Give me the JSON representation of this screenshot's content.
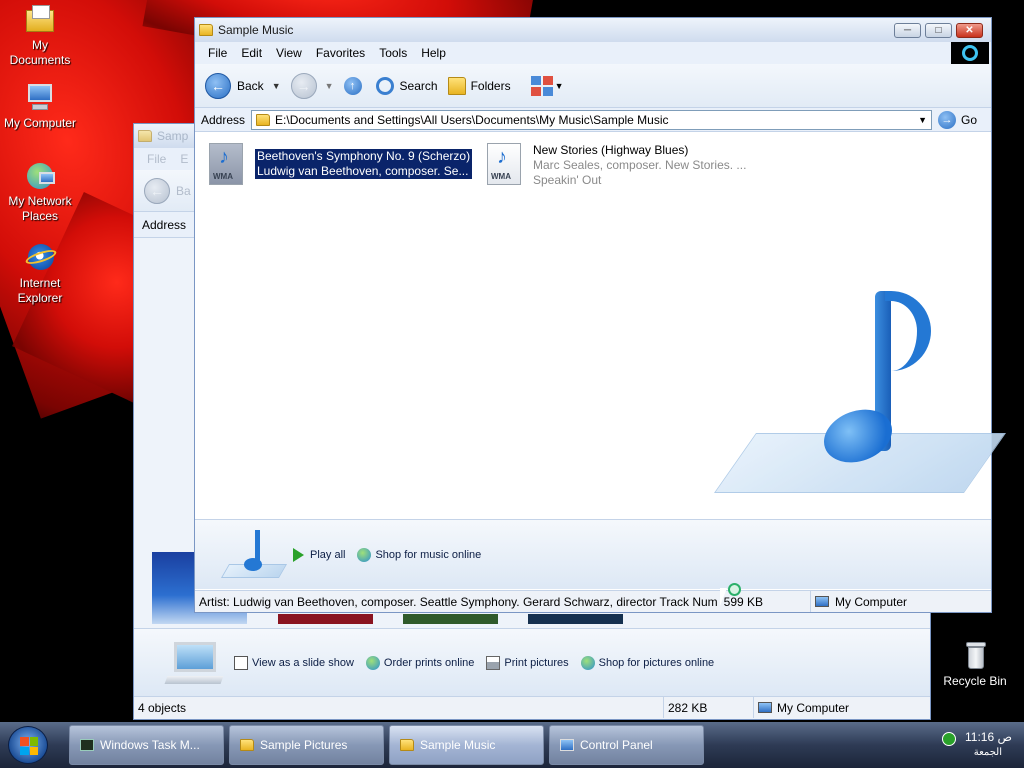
{
  "desktop_icons": [
    {
      "label": "My Documents",
      "icon": "my-documents-icon"
    },
    {
      "label": "My Computer",
      "icon": "my-computer-icon"
    },
    {
      "label": "My Network Places",
      "icon": "network-places-icon"
    },
    {
      "label": "Internet Explorer",
      "icon": "internet-explorer-icon"
    },
    {
      "label": "Recycle Bin",
      "icon": "recycle-bin-icon"
    }
  ],
  "back_window": {
    "title_fragment": "Samp",
    "menu_fragment_1": "File",
    "menu_fragment_2": "E",
    "back_fragment": "Ba",
    "address_label": "Address",
    "task_links": {
      "slideshow": "View as a slide show",
      "order_prints": "Order prints online",
      "print_pictures": "Print pictures",
      "shop_pictures": "Shop for pictures online"
    },
    "status": {
      "objects": "4 objects",
      "size": "282 KB",
      "location": "My Computer"
    }
  },
  "main_window": {
    "title": "Sample Music",
    "menu": [
      "File",
      "Edit",
      "View",
      "Favorites",
      "Tools",
      "Help"
    ],
    "toolbar": {
      "back": "Back",
      "search": "Search",
      "folders": "Folders"
    },
    "address": {
      "label": "Address",
      "path": "E:\\Documents and Settings\\All Users\\Documents\\My Music\\Sample Music",
      "go": "Go"
    },
    "files": [
      {
        "name": "Beethoven's Symphony No. 9 (Scherzo)",
        "line2": "Ludwig van Beethoven, composer. Se...",
        "line3": "",
        "badge": "WMA",
        "selected": true
      },
      {
        "name": "New Stories (Highway Blues)",
        "line2": "Marc Seales, composer. New Stories. ...",
        "line3": "Speakin' Out",
        "badge": "WMA",
        "selected": false
      }
    ],
    "task_links": {
      "play_all": "Play all",
      "shop_music": "Shop for music online"
    },
    "status": {
      "details": "Artist: Ludwig van Beethoven, composer. Seattle Symphony. Gerard Schwarz, director Track Num",
      "size": "599 KB",
      "location": "My Computer"
    }
  },
  "taskbar": {
    "buttons": [
      {
        "label": "Windows Task M...",
        "active": false
      },
      {
        "label": "Sample Pictures",
        "active": false
      },
      {
        "label": "Sample Music",
        "active": true
      },
      {
        "label": "Control Panel",
        "active": false
      }
    ],
    "clock": {
      "time": "11:16 ص",
      "day": "الجمعة"
    }
  },
  "colors": {
    "accent_blue": "#2a6fc4",
    "selection": "#0a246a",
    "wallpaper_red": "#d20d08"
  }
}
